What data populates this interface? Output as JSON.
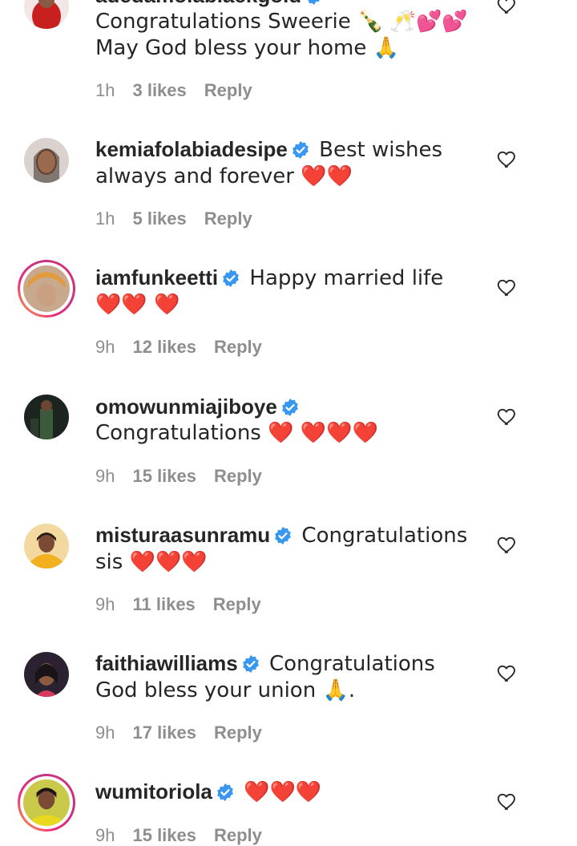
{
  "comments": [
    {
      "username": "adedamolablackgold",
      "text": "Congratulations Sweerie 🍾 🥂💕💕 May God bless your home 🙏",
      "time": "1h",
      "likes": "3 likes",
      "reply": "Reply",
      "story_ring": false
    },
    {
      "username": "kemiafolabiadesipe",
      "text": "Best wishes always and forever ❤️❤️",
      "time": "1h",
      "likes": "5 likes",
      "reply": "Reply",
      "story_ring": false
    },
    {
      "username": "iamfunkeetti",
      "text": "Happy married life ❤️❤️ ❤️",
      "time": "9h",
      "likes": "12 likes",
      "reply": "Reply",
      "story_ring": true
    },
    {
      "username": "omowunmiajiboye",
      "text": "Congratulations ❤️ ❤️❤️❤️",
      "time": "9h",
      "likes": "15 likes",
      "reply": "Reply",
      "story_ring": false
    },
    {
      "username": "misturaasunramu",
      "text": "Congratulations sis ❤️❤️❤️",
      "time": "9h",
      "likes": "11 likes",
      "reply": "Reply",
      "story_ring": false
    },
    {
      "username": "faithiawilliams",
      "text": "Congratulations God bless your union 🙏.",
      "time": "9h",
      "likes": "17 likes",
      "reply": "Reply",
      "story_ring": false
    },
    {
      "username": "wumitoriola",
      "text": "❤️❤️❤️",
      "time": "9h",
      "likes": "15 likes",
      "reply": "Reply",
      "story_ring": true
    }
  ],
  "icons": {
    "verified": "verified-badge-icon",
    "like": "heart-outline-icon"
  },
  "colors": {
    "verified_blue": "#3897f0",
    "meta_gray": "#8e8e8e",
    "text": "#262626",
    "heart_red": "#e0102c"
  }
}
